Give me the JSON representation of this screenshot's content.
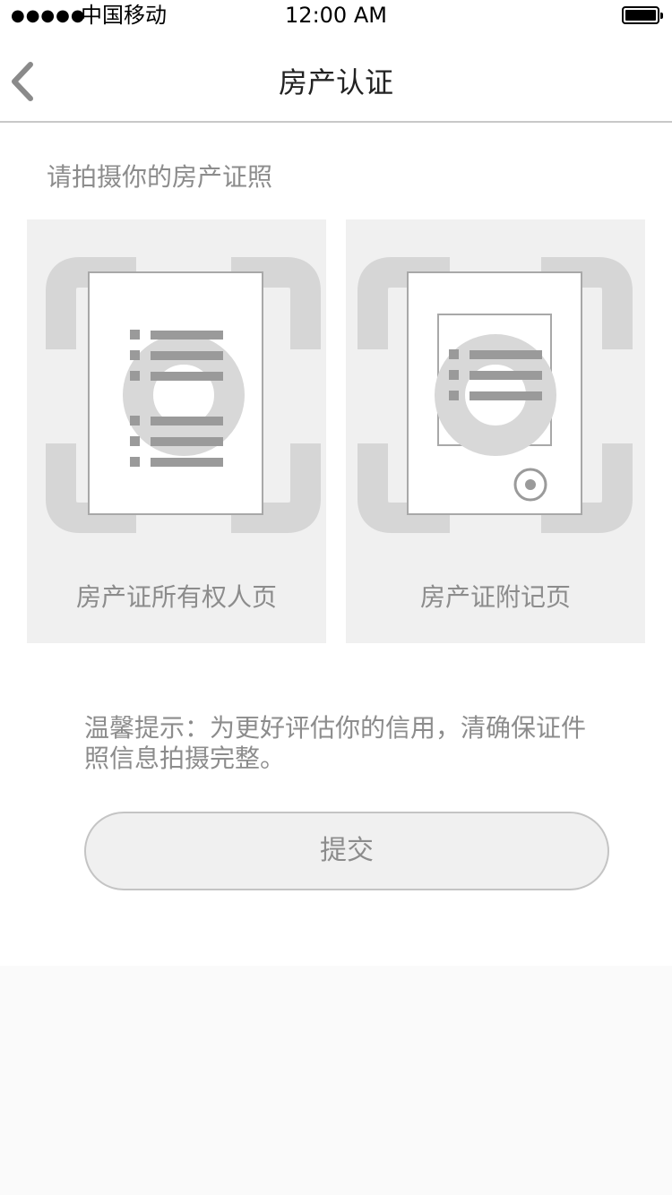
{
  "status_bar": {
    "signal": "●●●●●",
    "carrier": "中国移动",
    "time": "12:00 AM",
    "battery_icon": "battery-full-icon"
  },
  "nav": {
    "back_icon": "chevron-left-icon",
    "title": "房产认证"
  },
  "prompt": "请拍摄你的房产证照",
  "cards": [
    {
      "label": "房产证所有权人页",
      "icon": "document-scan-icon"
    },
    {
      "label": "房产证附记页",
      "icon": "document-scan-icon"
    }
  ],
  "tip": "温馨提示：为更好评估你的信用，清确保证件照信息拍摄完整。",
  "submit_label": "提交",
  "colors": {
    "card_bg": "#f0f0f0",
    "icon_gray": "#d6d6d6",
    "line_gray": "#9a9a9a",
    "text_gray": "#8c8c8c"
  }
}
